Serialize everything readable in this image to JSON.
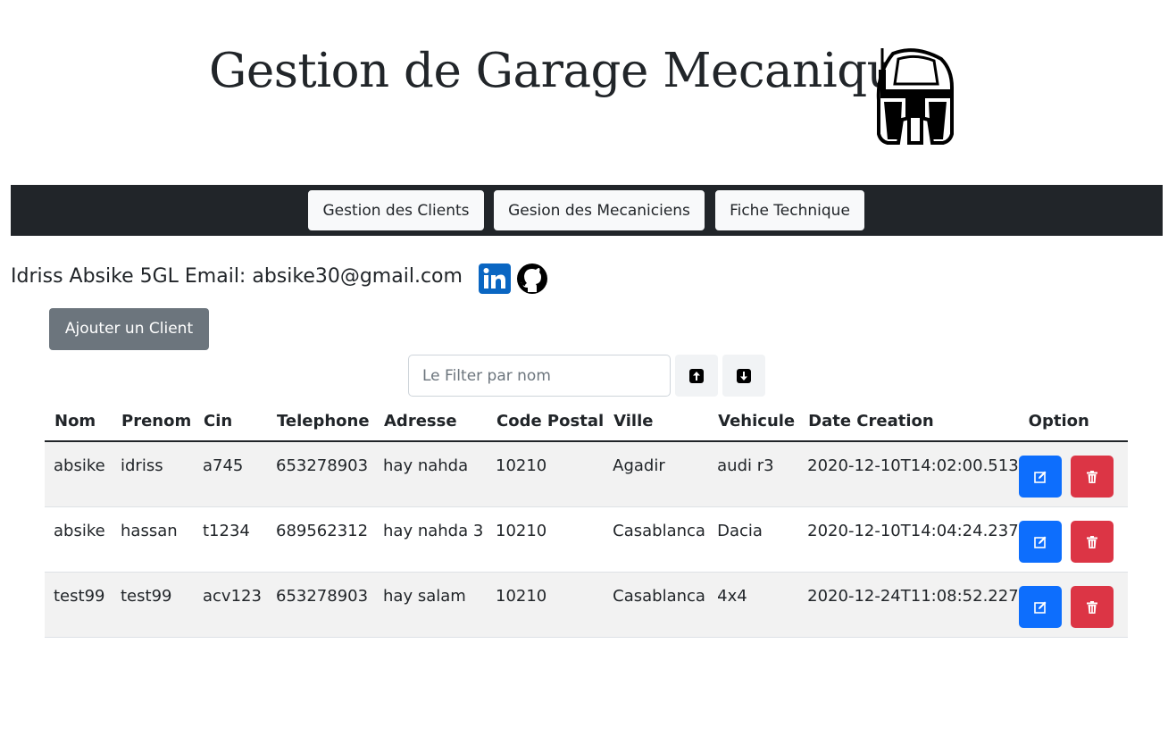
{
  "header": {
    "title": "Gestion de Garage Mecanique",
    "logo_icon": "helmet-logo-icon"
  },
  "nav": {
    "items": [
      {
        "label": "Gestion des Clients"
      },
      {
        "label": "Gesion des Mecaniciens"
      },
      {
        "label": "Fiche Technique"
      }
    ]
  },
  "author": {
    "text": "Idriss Absike 5GL Email: absike30@gmail.com",
    "icons": [
      "linkedin-icon",
      "github-icon"
    ]
  },
  "actions": {
    "add_label": "Ajouter un Client"
  },
  "filter": {
    "placeholder": "Le Filter par nom",
    "value": "",
    "sort_icons": [
      "arrow-up-icon",
      "arrow-down-icon"
    ]
  },
  "table": {
    "columns": [
      "Nom",
      "Prenom",
      "Cin",
      "Telephone",
      "Adresse",
      "Code Postal",
      "Ville",
      "Vehicule",
      "Date Creation",
      "Option"
    ],
    "rows": [
      {
        "nom": "absike",
        "prenom": "idriss",
        "cin": "a745",
        "telephone": "653278903",
        "adresse": "hay nahda",
        "code_postal": "10210",
        "ville": "Agadir",
        "vehicule": "audi r3",
        "date": "2020-12-10T14:02:00.513"
      },
      {
        "nom": "absike",
        "prenom": "hassan",
        "cin": "t1234",
        "telephone": "689562312",
        "adresse": "hay nahda 3",
        "code_postal": "10210",
        "ville": "Casablanca",
        "vehicule": "Dacia",
        "date": "2020-12-10T14:04:24.237"
      },
      {
        "nom": "test99",
        "prenom": "test99",
        "cin": "acv123",
        "telephone": "653278903",
        "adresse": "hay salam",
        "code_postal": "10210",
        "ville": "Casablanca",
        "vehicule": "4x4",
        "date": "2020-12-24T11:08:52.227"
      }
    ]
  },
  "colors": {
    "navbar": "#212529",
    "add_button": "#6c757d",
    "edit_button": "#0d6efd",
    "delete_button": "#dc3545",
    "stripe": "#f2f2f2"
  }
}
